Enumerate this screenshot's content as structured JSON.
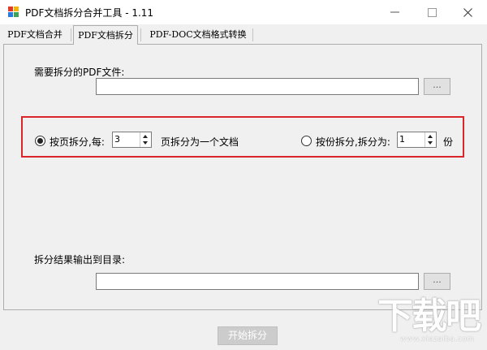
{
  "window": {
    "title": "PDF文档拆分合并工具 - 1.11",
    "minimize_glyph": "—",
    "maximize_glyph": "☐",
    "close_glyph": "✕"
  },
  "tabs": [
    {
      "label": "PDF文档合并",
      "active": false
    },
    {
      "label": "PDF文档拆分",
      "active": true
    },
    {
      "label": "PDF-DOC文档格式转换",
      "active": false
    }
  ],
  "split": {
    "source_label": "需要拆分的PDF文件:",
    "source_value": "",
    "browse_label": "...",
    "by_page_label": "按页拆分,每:",
    "by_page_value": "3",
    "by_page_suffix": "页拆分为一个文档",
    "by_page_selected": true,
    "by_count_label": "按份拆分,拆分为:",
    "by_count_value": "1",
    "by_count_suffix": "份",
    "by_count_selected": false,
    "output_label": "拆分结果输出到目录:",
    "output_value": "",
    "output_browse_label": "...",
    "start_button": "开始拆分"
  },
  "watermark": {
    "big": "下载吧",
    "small": "www.xiazaiba.com"
  },
  "colors": {
    "highlight": "#d9262b",
    "window_bg": "#f0f0f0"
  }
}
